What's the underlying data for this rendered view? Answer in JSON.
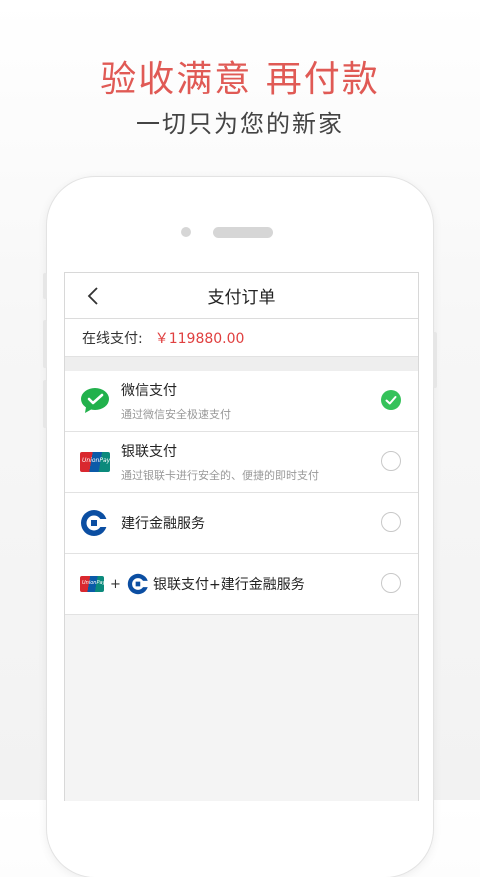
{
  "promo": {
    "headline": "验收满意  再付款",
    "subline": "一切只为您的新家",
    "headline_color": "#e05a55"
  },
  "screen": {
    "nav": {
      "title": "支付订单",
      "back_icon": "chevron-left-icon"
    },
    "online_payment": {
      "label": "在线支付:",
      "amount": "￥119880.00"
    },
    "methods": [
      {
        "name": "微信支付",
        "desc": "通过微信安全极速支付",
        "icon": "wechat-pay-icon",
        "selected": true
      },
      {
        "name": "银联支付",
        "desc": "通过银联卡进行安全的、便捷的即时支付",
        "icon": "unionpay-icon",
        "selected": false
      },
      {
        "name": "建行金融服务",
        "desc": "",
        "icon": "ccb-icon",
        "selected": false
      },
      {
        "name": "银联支付+建行金融服务",
        "desc": "",
        "icon": "unionpay-plus-ccb-icon",
        "plus": "+",
        "selected": false
      }
    ],
    "unionpay_logo_text": "UnionPay 银联",
    "colors": {
      "accent_green": "#35c25a",
      "amount_red": "#e04040",
      "ccb_blue": "#0b4ea2"
    }
  }
}
